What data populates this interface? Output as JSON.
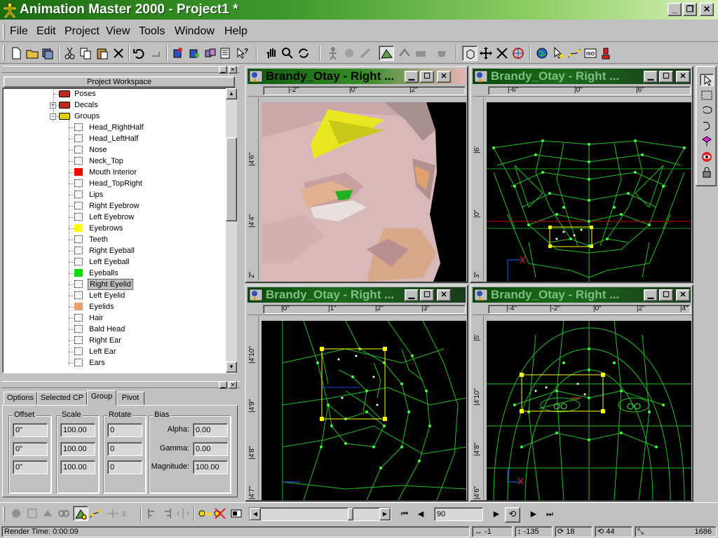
{
  "window": {
    "title": "Animation Master 2000 - Project1 *",
    "controls": [
      "_",
      "❐",
      "✕"
    ]
  },
  "menu": [
    "File",
    "Edit",
    "Project",
    "View",
    "Tools",
    "Window",
    "Help"
  ],
  "workspace": {
    "caption": "Project Workspace",
    "items": [
      {
        "label": "Poses",
        "color": "#c0281e",
        "kind": "folder-red"
      },
      {
        "label": "Decals",
        "color": "#c0281e",
        "kind": "folder-red"
      },
      {
        "label": "Groups",
        "color": "#e0d000",
        "kind": "folder-yellow"
      },
      {
        "label": "Head_RightHalf",
        "color": "#ffffff"
      },
      {
        "label": "Head_LeftHalf",
        "color": "#ffffff"
      },
      {
        "label": "Nose",
        "color": "#ffffff"
      },
      {
        "label": "Neck_Top",
        "color": "#ffffff"
      },
      {
        "label": "Mouth Interior",
        "color": "#ff0000"
      },
      {
        "label": "Head_TopRight",
        "color": "#ffffff"
      },
      {
        "label": "Lips",
        "color": "#ffffff"
      },
      {
        "label": "Right Eyebrow",
        "color": "#ffffff"
      },
      {
        "label": "Left Eyebrow",
        "color": "#ffffff"
      },
      {
        "label": "Eyebrows",
        "color": "#ffff00"
      },
      {
        "label": "Teeth",
        "color": "#ffffff"
      },
      {
        "label": "Right Eyeball",
        "color": "#ffffff"
      },
      {
        "label": "Left Eyeball",
        "color": "#ffffff"
      },
      {
        "label": "Eyeballs",
        "color": "#00e000"
      },
      {
        "label": "Right Eyelid",
        "color": "#ffffff",
        "selected": true
      },
      {
        "label": "Left Eyelid",
        "color": "#ffffff"
      },
      {
        "label": "Eyelids",
        "color": "#e8a070"
      },
      {
        "label": "Hair",
        "color": "#ffffff"
      },
      {
        "label": "Bald Head",
        "color": "#ffffff"
      },
      {
        "label": "Right Ear",
        "color": "#ffffff"
      },
      {
        "label": "Left Ear",
        "color": "#ffffff"
      },
      {
        "label": "Ears",
        "color": "#ffffff"
      }
    ]
  },
  "properties": {
    "tabs": [
      "Options",
      "Selected CP",
      "Group",
      "Pivot"
    ],
    "active_tab": "Group",
    "offset": {
      "label": "Offset",
      "values": [
        "0\"",
        "0\"",
        "0\""
      ]
    },
    "scale": {
      "label": "Scale",
      "values": [
        "100.00",
        "100.00",
        "100.00"
      ]
    },
    "rotate": {
      "label": "Rotate",
      "values": [
        "0",
        "0",
        "0"
      ]
    },
    "bias": {
      "label": "Bias",
      "alpha_label": "Alpha:",
      "alpha": "0.00",
      "gamma_label": "Gamma:",
      "gamma": "0.00",
      "magnitude_label": "Magnitude:",
      "magnitude": "100.00"
    }
  },
  "viewports": [
    {
      "title": "Brandy_Otay - Right ...",
      "active": true,
      "hticks": [
        "|-2\"",
        "|0\"",
        "|2\""
      ],
      "vticks": [
        "|4'6\"",
        "|4'4\"",
        "2\""
      ]
    },
    {
      "title": "Brandy_Otay - Right ...",
      "active": false,
      "hticks": [
        "|-6\"",
        "|0\"",
        "|6\""
      ],
      "vticks": [
        "|6'",
        "|0\"",
        "3\""
      ]
    },
    {
      "title": "Brandy_Otay - Right ...",
      "active": false,
      "hticks": [
        "|0\"",
        "|1\"",
        "|2\"",
        "|3\""
      ],
      "vticks": [
        "|4'10\"",
        "|4'9\"",
        "|4'8\"",
        "|4'7\""
      ]
    },
    {
      "title": "Brandy_Otay - Right ...",
      "active": false,
      "hticks": [
        "|-4\"",
        "|-2\"",
        "|0\"",
        "|2\"",
        "|4\""
      ],
      "vticks": [
        "|5'",
        "|4'10\"",
        "|4'8\"",
        "|4'6\""
      ]
    }
  ],
  "timeline": {
    "frame": "90"
  },
  "status": {
    "render_time": "Render Time:  0:00:09",
    "x": "-1",
    "y": "-135",
    "a": "18",
    "b": "44",
    "c": "1686"
  }
}
